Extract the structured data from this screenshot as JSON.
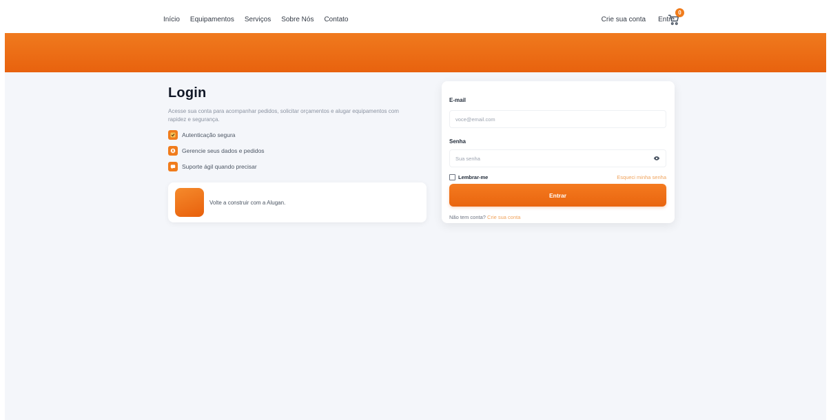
{
  "header": {
    "nav": [
      "Início",
      "Equipamentos",
      "Serviços",
      "Sobre Nós",
      "Contato"
    ],
    "create_account": "Crie sua conta",
    "login": "Entre",
    "cart_count": "0"
  },
  "login_info": {
    "title": "Login",
    "description": "Acesse sua conta para acompanhar pedidos, solicitar orçamentos e alugar equipamentos com rapidez e segurança.",
    "features": [
      "Autenticação segura",
      "Gerencie seus dados e pedidos",
      "Suporte ágil quando precisar"
    ],
    "promo_text": "Volte a construir com a Alugan."
  },
  "form": {
    "email_label": "E-mail",
    "email_placeholder": "voce@email.com",
    "password_label": "Senha",
    "password_placeholder": "Sua senha",
    "remember_label": "Lembrar-me",
    "forgot_link": "Esqueci minha senha",
    "submit_label": "Entrar",
    "signup_prompt": "Não tem conta?",
    "signup_link": "Crie sua conta"
  },
  "colors": {
    "accent": "#f07c1c",
    "background": "#f4f6fa"
  }
}
